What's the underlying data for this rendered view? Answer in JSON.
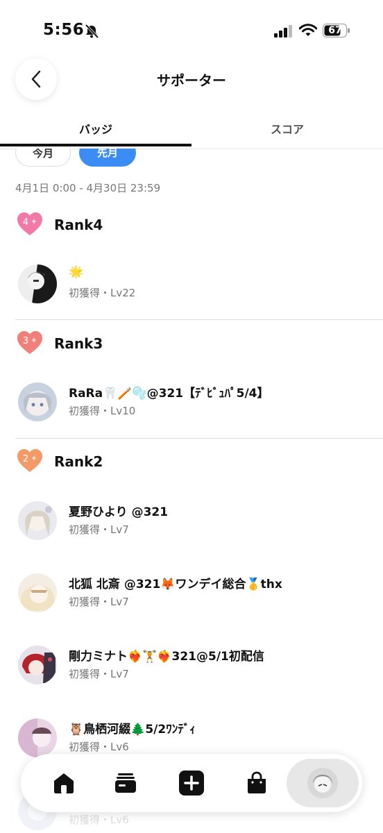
{
  "status_bar": {
    "time": "5:56",
    "battery": "67"
  },
  "header": {
    "title": "サポーター"
  },
  "tabs": [
    {
      "label": "バッジ"
    },
    {
      "label": "スコア"
    }
  ],
  "filters": {
    "this_month": "今月",
    "last_month": "先月"
  },
  "date_range": "4月1日 0:00 - 4月30日 23:59",
  "ranks": [
    {
      "label": "Rank4",
      "number": "4",
      "color": "#f27aa8"
    },
    {
      "label": "Rank3",
      "number": "3",
      "color": "#f2807a"
    },
    {
      "label": "Rank2",
      "number": "2",
      "color": "#f39a66"
    }
  ],
  "supporters": [
    {
      "name": "🌟",
      "meta": "初獲得・Lv22"
    },
    {
      "name": "RaRa🦷🪥🫧@321【ﾃﾞﾋﾞｭﾊﾟ5/4】",
      "meta": "初獲得・Lv10"
    },
    {
      "name": "夏野ひより @321",
      "meta": "初獲得・Lv7"
    },
    {
      "name": "北狐 北斎 @321🦊ワンデイ総合🥇thx",
      "meta": "初獲得・Lv7"
    },
    {
      "name": "剛力ミナト❤️‍🔥🏋️❤️‍🔥321@5/1初配信",
      "meta": "初獲得・Lv7"
    },
    {
      "name": "🦉鳥栖河綴🌲5/2ﾜﾝﾃﾞｨ",
      "meta": "初獲得・Lv6"
    },
    {
      "name": "",
      "meta": "初獲得・Lv6"
    }
  ],
  "nav": {
    "items": [
      "home-icon",
      "cards-icon",
      "plus-icon",
      "bag-icon",
      "profile-avatar"
    ]
  }
}
